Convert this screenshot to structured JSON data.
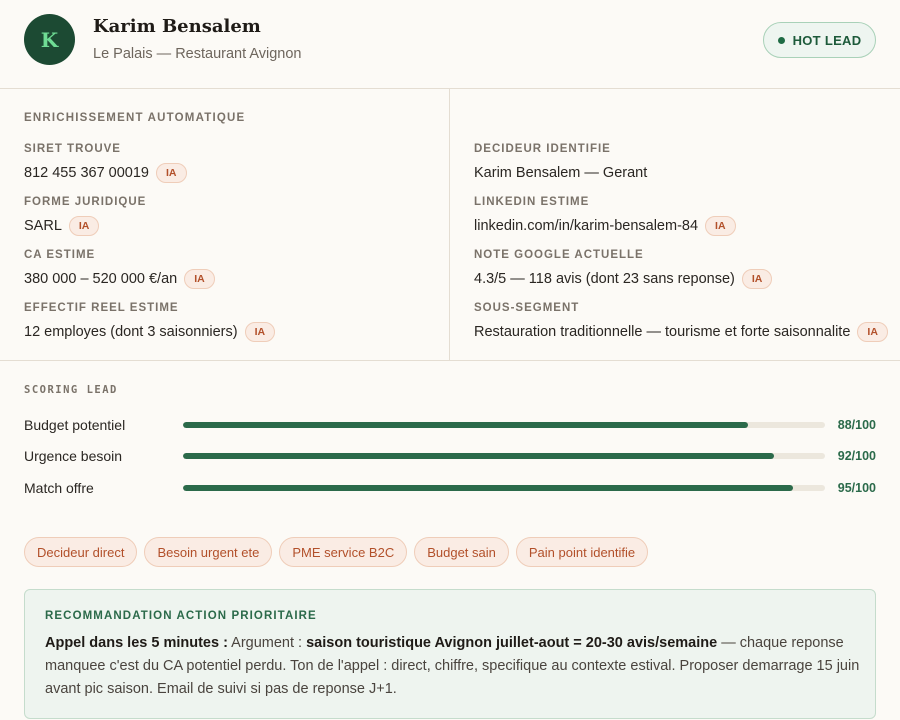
{
  "header": {
    "avatar_letter": "K",
    "name": "Karim Bensalem",
    "subtitle": "Le Palais — Restaurant Avignon",
    "badge": "HOT LEAD"
  },
  "enrichment": {
    "title": "ENRICHISSEMENT AUTOMATIQUE",
    "ia_label": "IA",
    "left": [
      {
        "label": "SIRET TROUVE",
        "value": "812 455 367 00019",
        "ia": true
      },
      {
        "label": "FORME JURIDIQUE",
        "value": "SARL",
        "ia": true
      },
      {
        "label": "CA ESTIME",
        "value": "380 000 – 520 000 €/an",
        "ia": true
      },
      {
        "label": "EFFECTIF REEL ESTIME",
        "value": "12 employes (dont 3 saisonniers)",
        "ia": true
      }
    ],
    "right": [
      {
        "label": "DECIDEUR IDENTIFIE",
        "value": "Karim Bensalem — Gerant",
        "ia": false
      },
      {
        "label": "LINKEDIN ESTIME",
        "value": "linkedin.com/in/karim-bensalem-84",
        "ia": true
      },
      {
        "label": "NOTE GOOGLE ACTUELLE",
        "value": "4.3/5 — 118 avis (dont 23 sans reponse)",
        "ia": true
      },
      {
        "label": "SOUS-SEGMENT",
        "value": "Restauration traditionnelle — tourisme et forte saisonnalite",
        "ia": true
      }
    ]
  },
  "scoring": {
    "title": "SCORING LEAD",
    "rows": [
      {
        "label": "Budget potentiel",
        "score": 88,
        "display": "88/100"
      },
      {
        "label": "Urgence besoin",
        "score": 92,
        "display": "92/100"
      },
      {
        "label": "Match offre",
        "score": 95,
        "display": "95/100"
      }
    ]
  },
  "tags": [
    "Decideur direct",
    "Besoin urgent ete",
    "PME service B2C",
    "Budget sain",
    "Pain point identifie"
  ],
  "recommendation": {
    "title": "RECOMMANDATION ACTION PRIORITAIRE",
    "lead": "Appel dans les 5 minutes :",
    "argument_prefix": " Argument : ",
    "argument": "saison touristique Avignon juillet-aout = 20-30 avis/semaine",
    "rest": " — chaque reponse manquee c'est du CA potentiel perdu. Ton de l'appel : direct, chiffre, specifique au contexte estival. Proposer demarrage 15 juin avant pic saison. Email de suivi si pas de reponse J+1."
  },
  "colors": {
    "accent_green": "#2b6a4a",
    "avatar_bg": "#1c4a33",
    "tag_text": "#b2502a"
  }
}
